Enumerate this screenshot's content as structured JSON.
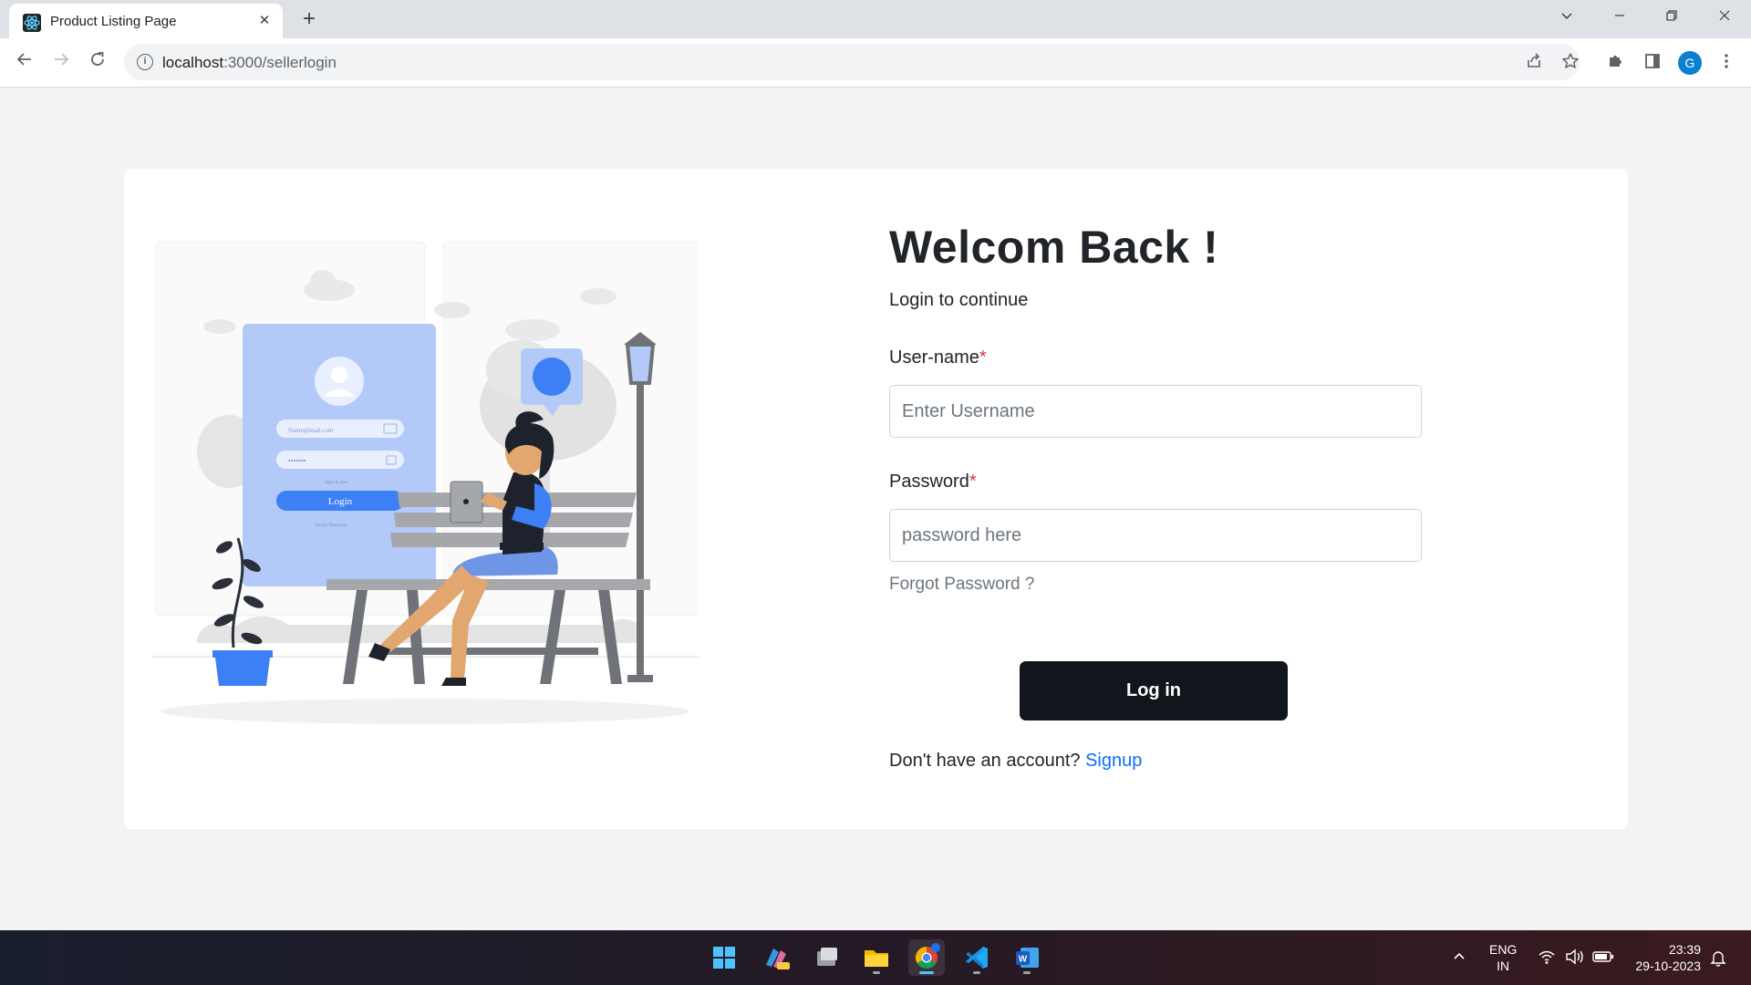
{
  "browser": {
    "tab_title": "Product Listing Page",
    "tab_close": "✕",
    "new_tab": "+",
    "url_host": "localhost",
    "url_path": ":3000/sellerlogin",
    "profile_initial": "G"
  },
  "illustration": {
    "card_email_placeholder": "Name@mail.com",
    "card_password_mask": "•••••••",
    "card_signup": "Sign up now",
    "card_login": "Login",
    "card_forgot": "Forgot Password"
  },
  "login": {
    "heading": "Welcom Back !",
    "subheading": "Login to continue",
    "username_label": "User-name",
    "username_placeholder": "Enter Username",
    "password_label": "Password",
    "password_placeholder": "password here",
    "required_mark": "*",
    "forgot": "Forgot Password ?",
    "login_button": "Log in",
    "no_account": "Don't have an account?",
    "signup": "Signup"
  },
  "taskbar": {
    "lang": "ENG",
    "region": "IN",
    "time": "23:39",
    "date": "29-10-2023"
  },
  "colors": {
    "accent": "#0d6efd",
    "button": "#11161c",
    "required": "#dc3545",
    "illustration_blue": "#3d7ff5",
    "illustration_light_blue": "#b3caf8"
  }
}
